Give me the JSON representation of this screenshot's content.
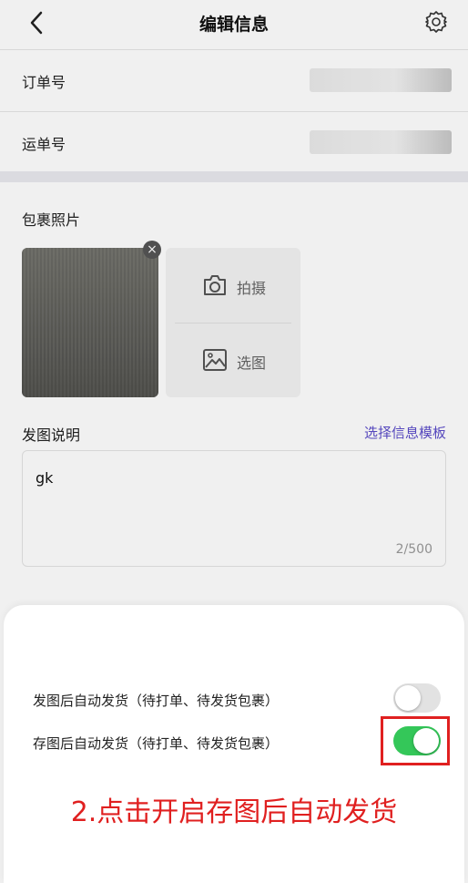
{
  "header": {
    "title": "编辑信息"
  },
  "order_row": {
    "label": "订单号"
  },
  "tracking_row": {
    "label": "运单号"
  },
  "photos": {
    "label": "包裹照片",
    "actions": [
      {
        "label": "拍摄",
        "icon": "camera-icon"
      },
      {
        "label": "选图",
        "icon": "image-icon"
      }
    ]
  },
  "description": {
    "label": "发图说明",
    "template_link": "选择信息模板",
    "value": "gk",
    "counter": "2/500"
  },
  "sheet": {
    "options": [
      {
        "label": "发图后自动发货（待打单、待发货包裹）",
        "enabled": false
      },
      {
        "label": "存图后自动发货（待打单、待发货包裹）",
        "enabled": true
      }
    ]
  },
  "annotation": {
    "text": "2.点击开启存图后自动发货",
    "color": "#e02020"
  },
  "colors": {
    "accent": "#5b4cc9",
    "toggle_on": "#34c759",
    "toggle_off": "#e2e2e2"
  }
}
